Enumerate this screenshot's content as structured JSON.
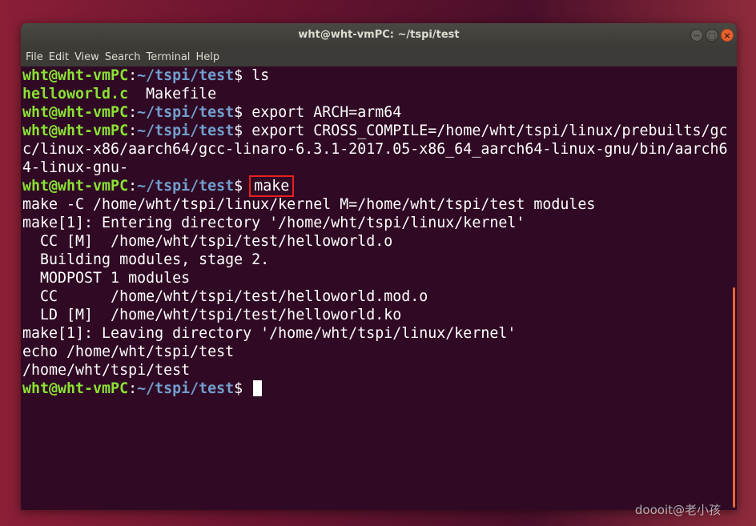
{
  "window": {
    "title": "wht@wht-vmPC: ~/tspi/test",
    "controls": {
      "minimize": "−",
      "maximize": "□",
      "close": "×"
    }
  },
  "menubar": {
    "items": [
      "File",
      "Edit",
      "View",
      "Search",
      "Terminal",
      "Help"
    ]
  },
  "prompt": {
    "user_host": "wht@wht-vmPC",
    "colon": ":",
    "path": "~/tspi/test",
    "symbol": "$ "
  },
  "terminal": {
    "cmd_ls": "ls",
    "ls_file1": "helloworld.c",
    "ls_sep": "  ",
    "ls_file2": "Makefile",
    "cmd_export_arch": "export ARCH=arm64",
    "cmd_cross_1": "export CROSS_COMPILE=/home/wht/tspi/linux/prebuilts/gc",
    "cmd_cross_2": "c/linux-x86/aarch64/gcc-linaro-6.3.1-2017.05-x86_64_aarch64-linux-gnu/bin/aarch6",
    "cmd_cross_3": "4-linux-gnu-",
    "cmd_make": "make",
    "out": [
      "make -C /home/wht/tspi/linux/kernel M=/home/wht/tspi/test modules",
      "make[1]: Entering directory '/home/wht/tspi/linux/kernel'",
      "  CC [M]  /home/wht/tspi/test/helloworld.o",
      "  Building modules, stage 2.",
      "  MODPOST 1 modules",
      "  CC      /home/wht/tspi/test/helloworld.mod.o",
      "  LD [M]  /home/wht/tspi/test/helloworld.ko",
      "make[1]: Leaving directory '/home/wht/tspi/linux/kernel'",
      "echo /home/wht/tspi/test",
      "/home/wht/tspi/test"
    ]
  },
  "watermark": "doooit@老小孩",
  "colors": {
    "terminal_bg": "#300a24",
    "prompt_user": "#8ae234",
    "prompt_path": "#729fcf",
    "highlight_box": "#e8201f",
    "close_button": "#e9602f"
  }
}
